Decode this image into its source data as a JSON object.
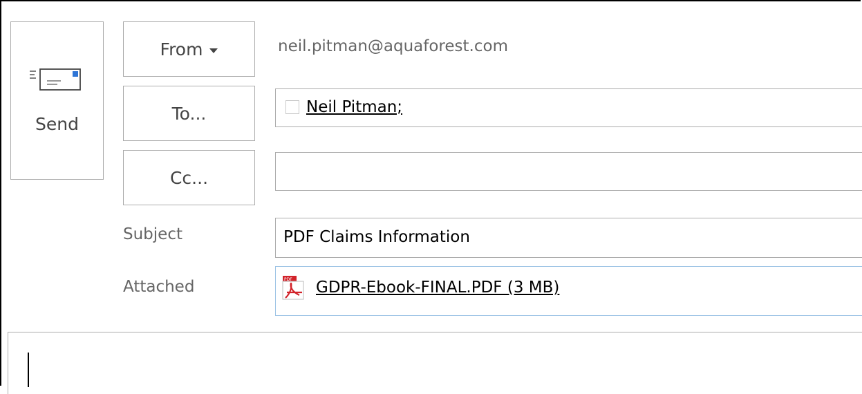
{
  "compose": {
    "send_label": "Send",
    "from_label": "From",
    "to_label": "To...",
    "cc_label": "Cc...",
    "from_email": "neil.pitman@aquaforest.com",
    "to_recipient": "Neil Pitman;",
    "cc_value": "",
    "subject_label": "Subject",
    "subject_value": "PDF Claims Information",
    "attached_label": "Attached",
    "attachment_name": "GDPR-Ebook-FINAL.PDF (3 MB)",
    "body_text": ""
  },
  "icons": {
    "send": "envelope-send-icon",
    "from_dropdown": "chevron-down-icon",
    "recipient_check": "checkbox-icon",
    "attachment": "pdf-file-icon"
  },
  "colors": {
    "frame_border": "#000000",
    "button_border": "#ababab",
    "attached_border": "#9cc3e5",
    "label_text": "#666666",
    "pdf_red": "#d2232a",
    "send_accent": "#2e75d6"
  }
}
